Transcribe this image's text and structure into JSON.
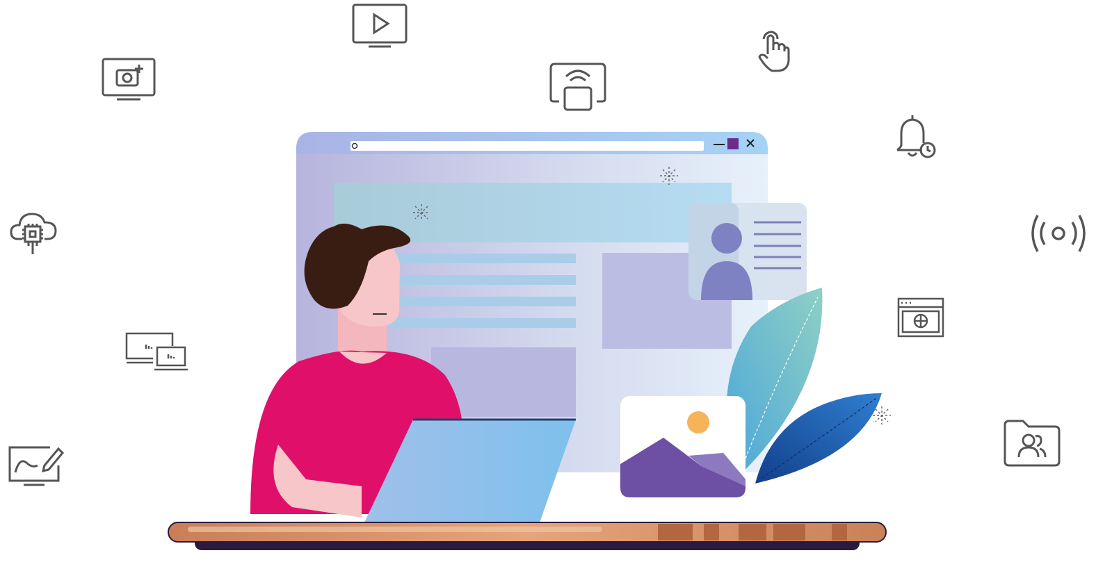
{
  "scene": {
    "colors": {
      "line_icon": "#555555",
      "shirt": "#e0106a",
      "hair": "#3a1d12",
      "skin": "#f7c6c9",
      "laptop": "#8fc2ee",
      "desk_top": "#d98f62",
      "desk_base": "#2a1a3c",
      "browser_bar": "#a9cdf2",
      "browser_body": "#c7cbe8",
      "leaf_light": "#7cc8d6",
      "leaf_dark": "#1b5fb0",
      "sun": "#f5b45a",
      "mountain": "#6d4fa3"
    },
    "floating_icons": [
      "tv-play-icon",
      "camera-add-icon",
      "screen-cast-icon",
      "touch-hand-icon",
      "bell-clock-icon",
      "cloud-chip-icon",
      "broadcast-signal-icon",
      "browser-globe-icon",
      "multi-device-icon",
      "drawing-tablet-icon",
      "shared-folder-icon"
    ],
    "illustration_elements": [
      "browser-window",
      "profile-card",
      "image-card",
      "leaves",
      "person",
      "laptop",
      "desk"
    ]
  }
}
